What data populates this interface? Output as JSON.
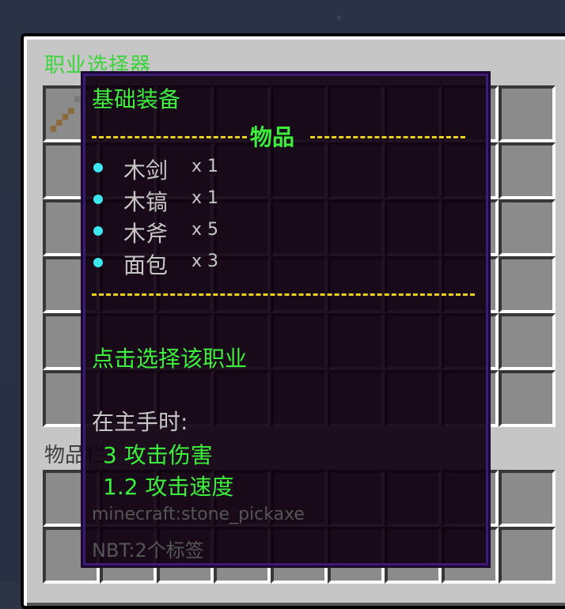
{
  "gui": {
    "title": "职业选择器",
    "inventory_label": "物品栏"
  },
  "tooltip": {
    "name": "基础装备",
    "section_header": "物品",
    "items": [
      {
        "name": "木剑",
        "qty": "x 1"
      },
      {
        "name": "木镐",
        "qty": "x 1"
      },
      {
        "name": "木斧",
        "qty": "x 5"
      },
      {
        "name": "面包",
        "qty": "x 3"
      }
    ],
    "action": "点击选择该职业",
    "main_hand_label": "在主手时:",
    "attack_damage": "3 攻击伤害",
    "attack_speed": "1.2 攻击速度",
    "item_id": "minecraft:stone_pickaxe",
    "nbt": "NBT:2个标签"
  },
  "colors": {
    "accent_green": "#3cf03c",
    "divider_yellow": "#e8d020",
    "bullet_cyan": "#3ee6f0",
    "tooltip_border": "#3b1a78"
  },
  "icons": [
    "stone-pickaxe-icon",
    "sword-icon",
    "pickaxe-icon",
    "book-icon",
    "apple-icon",
    "tnt-icon",
    "feather-icon"
  ]
}
